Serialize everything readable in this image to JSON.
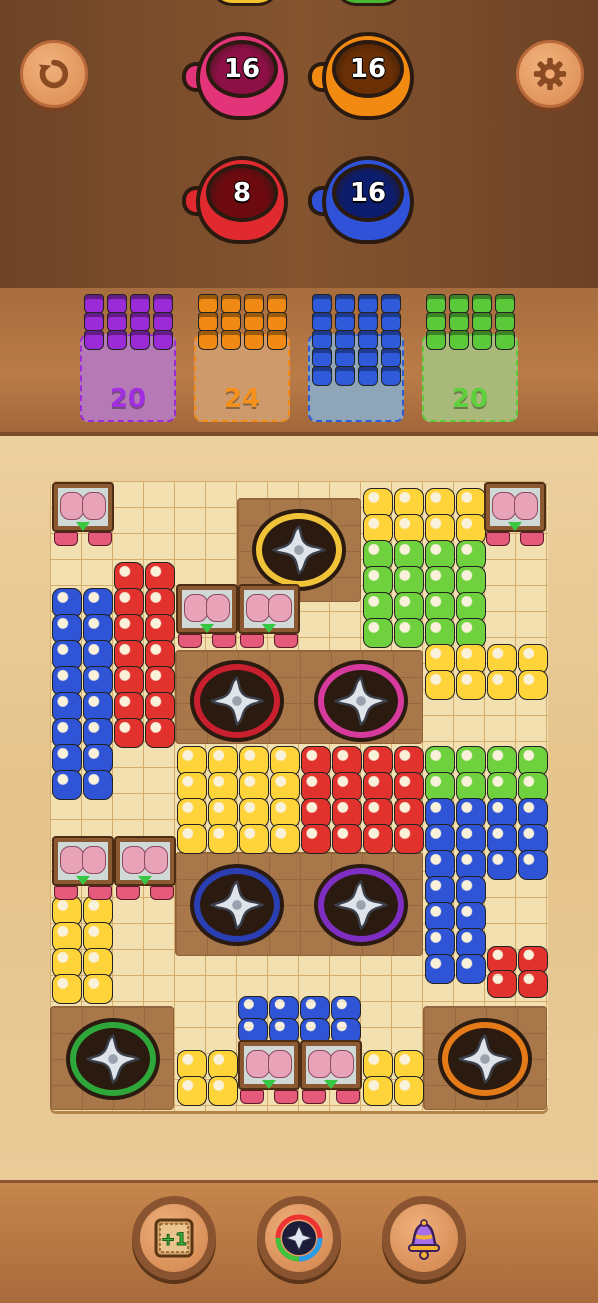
{
  "header": {
    "undo_icon": "undo-icon",
    "settings_icon": "gear-icon"
  },
  "cups": [
    {
      "id": "pink",
      "count": "16",
      "color": "#e3347a",
      "inner": "#8c0f45"
    },
    {
      "id": "orange",
      "count": "16",
      "color": "#f28a12",
      "inner": "#6a2f05"
    },
    {
      "id": "red",
      "count": "8",
      "color": "#e02a2f",
      "inner": "#6c0a10"
    },
    {
      "id": "blue",
      "count": "16",
      "color": "#2f52d8",
      "inner": "#0d1d6e"
    }
  ],
  "top_partial_cups_colors": [
    "#f5c22b",
    "#48b832"
  ],
  "tray": {
    "bins": [
      {
        "id": "purple",
        "count": "20",
        "color": "#9a2bd6",
        "text_color": "#a02fe0",
        "zone": "#b57ab5"
      },
      {
        "id": "orange",
        "count": "24",
        "color": "#f08a15",
        "text_color": "#f5901b",
        "zone": "#cf9a6b"
      },
      {
        "id": "blue",
        "count": "",
        "color": "#2f5ad9",
        "text_color": "#2f5ad9",
        "zone": "#8ea6b8"
      },
      {
        "id": "green",
        "count": "20",
        "color": "#5cc93a",
        "text_color": "#5ed03c",
        "zone": "#a9b97a"
      }
    ]
  },
  "board": {
    "spinners": [
      {
        "id": "yellow",
        "color": "#f0c338"
      },
      {
        "id": "red",
        "color": "#c91f2e"
      },
      {
        "id": "magenta",
        "color": "#d53a9c"
      },
      {
        "id": "blue",
        "color": "#2a3fb3"
      },
      {
        "id": "purple",
        "color": "#7e2ec2"
      },
      {
        "id": "green",
        "color": "#2ea63a"
      },
      {
        "id": "orange",
        "color": "#e57a18"
      }
    ],
    "colors": {
      "yellow": "#ffd43b",
      "green": "#6fd13d",
      "blue": "#2f55d6",
      "red": "#e2322e"
    }
  },
  "toolbar": {
    "add_moves_label": "+1",
    "items": [
      "plus-one-crate-icon",
      "rainbow-spinner-icon",
      "bell-icon"
    ]
  }
}
